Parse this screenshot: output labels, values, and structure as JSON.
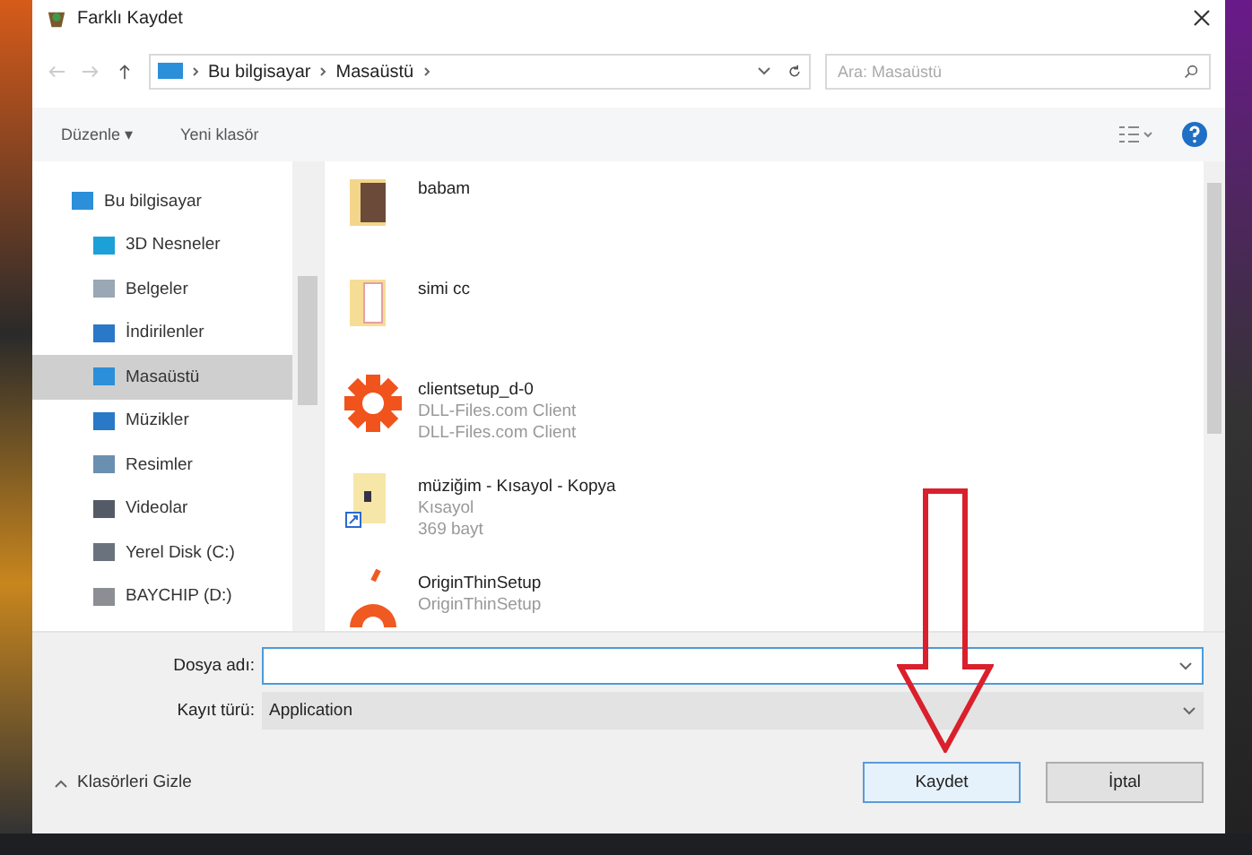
{
  "window": {
    "title": "Farklı Kaydet"
  },
  "address": {
    "path": [
      {
        "label": "Bu bilgisayar"
      },
      {
        "label": "Masaüstü"
      }
    ],
    "search_placeholder": "Ara: Masaüstü"
  },
  "toolbar": {
    "organize": "Düzenle ▾",
    "new_folder": "Yeni klasör"
  },
  "sidebar": {
    "items": [
      {
        "label": "Bu bilgisayar",
        "kind": "pc",
        "selected": false,
        "children": [
          {
            "label": "3D Nesneler",
            "kind": "cube",
            "selected": false
          },
          {
            "label": "Belgeler",
            "kind": "doc",
            "selected": false
          },
          {
            "label": "İndirilenler",
            "kind": "download",
            "selected": false
          },
          {
            "label": "Masaüstü",
            "kind": "desktop",
            "selected": true
          },
          {
            "label": "Müzikler",
            "kind": "music",
            "selected": false
          },
          {
            "label": "Resimler",
            "kind": "pictures",
            "selected": false
          },
          {
            "label": "Videolar",
            "kind": "video",
            "selected": false
          },
          {
            "label": "Yerel Disk (C:)",
            "kind": "disk",
            "selected": false
          },
          {
            "label": "BAYCHIP (D:)",
            "kind": "usb",
            "selected": false
          }
        ]
      }
    ]
  },
  "files": [
    {
      "name": "babam",
      "kind": "photo-folder"
    },
    {
      "name": "simi cc",
      "kind": "folder"
    },
    {
      "name": "clientsetup_d-0",
      "kind": "gear",
      "details": [
        "DLL-Files.com Client",
        "DLL-Files.com Client"
      ]
    },
    {
      "name": "müziğim - Kısayol - Kopya",
      "kind": "shortcut",
      "details": [
        "Kısayol",
        "369 bayt"
      ]
    },
    {
      "name": "OriginThinSetup",
      "kind": "origin",
      "details": [
        "OriginThinSetup"
      ]
    }
  ],
  "form": {
    "file_name_label": "Dosya adı:",
    "type_label": "Kayıt türü:",
    "type_value": "Application"
  },
  "footer": {
    "hide_folders": "Klasörleri Gizle",
    "save": "Kaydet",
    "cancel": "İptal"
  }
}
